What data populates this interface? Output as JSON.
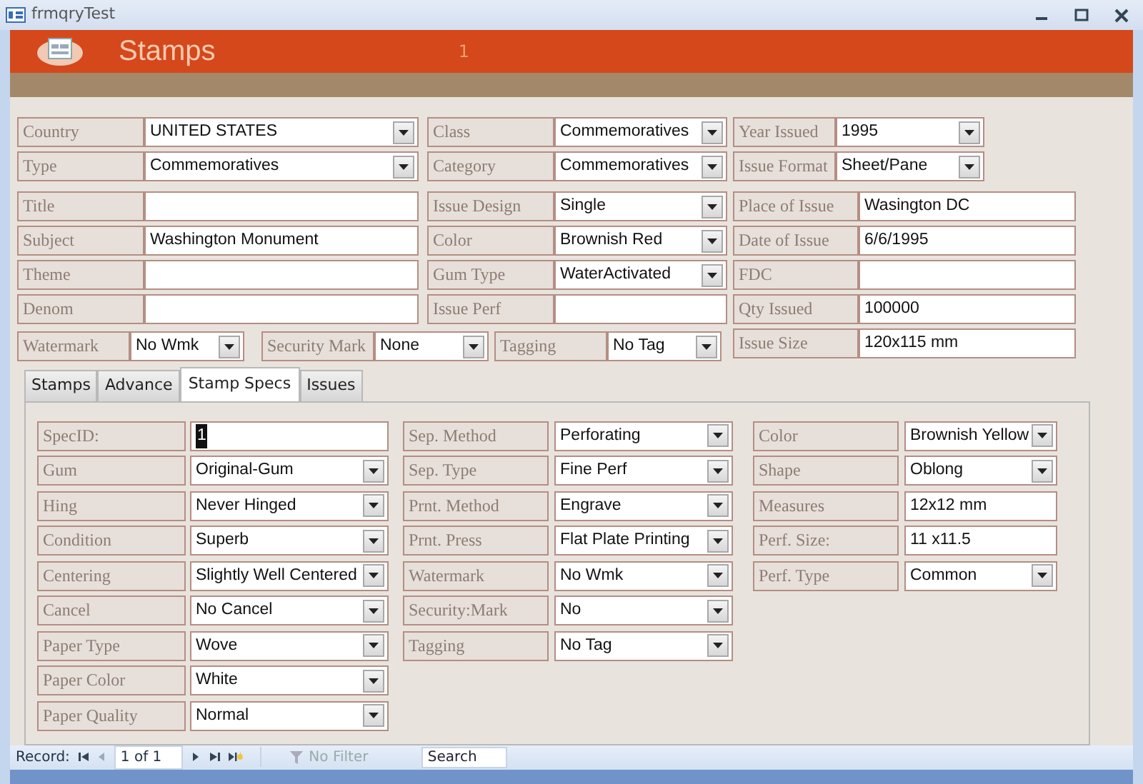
{
  "window": {
    "title": "frmqryTest"
  },
  "header": {
    "title": "Stamps",
    "record_number": "1"
  },
  "top_columns": [
    [
      {
        "label": "Country",
        "value": "UNITED STATES",
        "kind": "combo"
      },
      {
        "label": "Type",
        "value": "Commemoratives",
        "kind": "combo"
      },
      {
        "label": "Title",
        "kind": "text"
      },
      {
        "label": "Subject",
        "value": "Washington Monument",
        "kind": "text"
      },
      {
        "label": "Theme",
        "kind": "text"
      },
      {
        "label": "Denom",
        "kind": "text"
      }
    ],
    [
      {
        "label": "Class",
        "value": "Commemoratives",
        "kind": "combo"
      },
      {
        "label": "Category",
        "value": "Commemoratives",
        "kind": "combo"
      },
      {
        "label": "Issue Design",
        "value": "Single",
        "kind": "combo"
      },
      {
        "label": "Color",
        "value": "Brownish Red",
        "kind": "combo"
      },
      {
        "label": "Gum Type",
        "value": "WaterActivated",
        "kind": "combo"
      },
      {
        "label": "Issue Perf",
        "kind": "text"
      }
    ],
    [
      {
        "label": "Year Issued",
        "value": "1995",
        "kind": "combo"
      },
      {
        "label": "Issue Format",
        "value": "Sheet/Pane",
        "kind": "combo"
      },
      {
        "label": "Place of Issue",
        "value": "Wasington DC",
        "kind": "text"
      },
      {
        "label": "Date of Issue",
        "value": "6/6/1995",
        "kind": "text"
      },
      {
        "label": "FDC",
        "kind": "text"
      },
      {
        "label": "Qty Issued",
        "value": "100000",
        "kind": "text"
      },
      {
        "label": "Issue Size",
        "value": "120x115 mm",
        "kind": "text"
      }
    ]
  ],
  "bottom_row": [
    {
      "label": "Watermark",
      "value": "No Wmk",
      "kind": "combo"
    },
    {
      "label": "Security Mark",
      "value": "None",
      "kind": "combo"
    },
    {
      "label": "Tagging",
      "value": "No Tag",
      "kind": "combo"
    }
  ],
  "tabs": [
    {
      "label": "Stamps",
      "selected": false
    },
    {
      "label": "Advance",
      "selected": false
    },
    {
      "label": "Stamp Specs",
      "selected": true
    },
    {
      "label": "Issues",
      "selected": false
    }
  ],
  "spec_columns": [
    [
      {
        "label": "SpecID:",
        "value": "1",
        "kind": "text",
        "selected": true
      },
      {
        "label": "Gum",
        "value": "Original-Gum",
        "kind": "combo",
        "selected": false
      },
      {
        "label": "Hing",
        "value": "Never Hinged",
        "kind": "combo",
        "selected": false
      },
      {
        "label": "Condition",
        "value": "Superb",
        "kind": "combo",
        "selected": false
      },
      {
        "label": "Centering",
        "value": "Slightly Well Centered",
        "kind": "combo",
        "selected": false
      },
      {
        "label": "Cancel",
        "value": "No Cancel",
        "kind": "combo",
        "selected": false
      },
      {
        "label": "Paper Type",
        "value": "Wove",
        "kind": "combo",
        "selected": false
      },
      {
        "label": "Paper Color",
        "value": "White",
        "kind": "combo",
        "selected": false
      },
      {
        "label": "Paper Quality",
        "value": "Normal",
        "kind": "combo",
        "selected": false
      }
    ],
    [
      {
        "label": "Sep. Method",
        "value": "Perforating",
        "kind": "combo",
        "selected": false
      },
      {
        "label": "Sep. Type",
        "value": "Fine Perf",
        "kind": "combo",
        "selected": false
      },
      {
        "label": "Prnt. Method",
        "value": "Engrave",
        "kind": "combo",
        "selected": false
      },
      {
        "label": "Prnt. Press",
        "value": "Flat Plate Printing",
        "kind": "combo",
        "selected": false
      },
      {
        "label": "Watermark",
        "value": "No Wmk",
        "kind": "combo",
        "selected": false
      },
      {
        "label": "Security:Mark",
        "value": "No",
        "kind": "combo",
        "selected": false
      },
      {
        "label": "Tagging",
        "value": "No Tag",
        "kind": "combo",
        "selected": false
      }
    ],
    [
      {
        "label": "Color",
        "value": "Brownish Yellow",
        "kind": "combo",
        "selected": false
      },
      {
        "label": "Shape",
        "value": "Oblong",
        "kind": "combo",
        "selected": false
      },
      {
        "label": "Measures",
        "value": "12x12 mm",
        "kind": "text",
        "selected": false
      },
      {
        "label": "Perf. Size:",
        "value": "11 x11.5",
        "kind": "text",
        "selected": false
      },
      {
        "label": "Perf. Type",
        "value": "Common",
        "kind": "combo",
        "selected": false
      }
    ]
  ],
  "status_bar": {
    "label": "Record:",
    "position": "1 of 1",
    "filter": {
      "label": "No Filter",
      "disabled": true
    },
    "search": {
      "placeholder": "Search"
    }
  }
}
